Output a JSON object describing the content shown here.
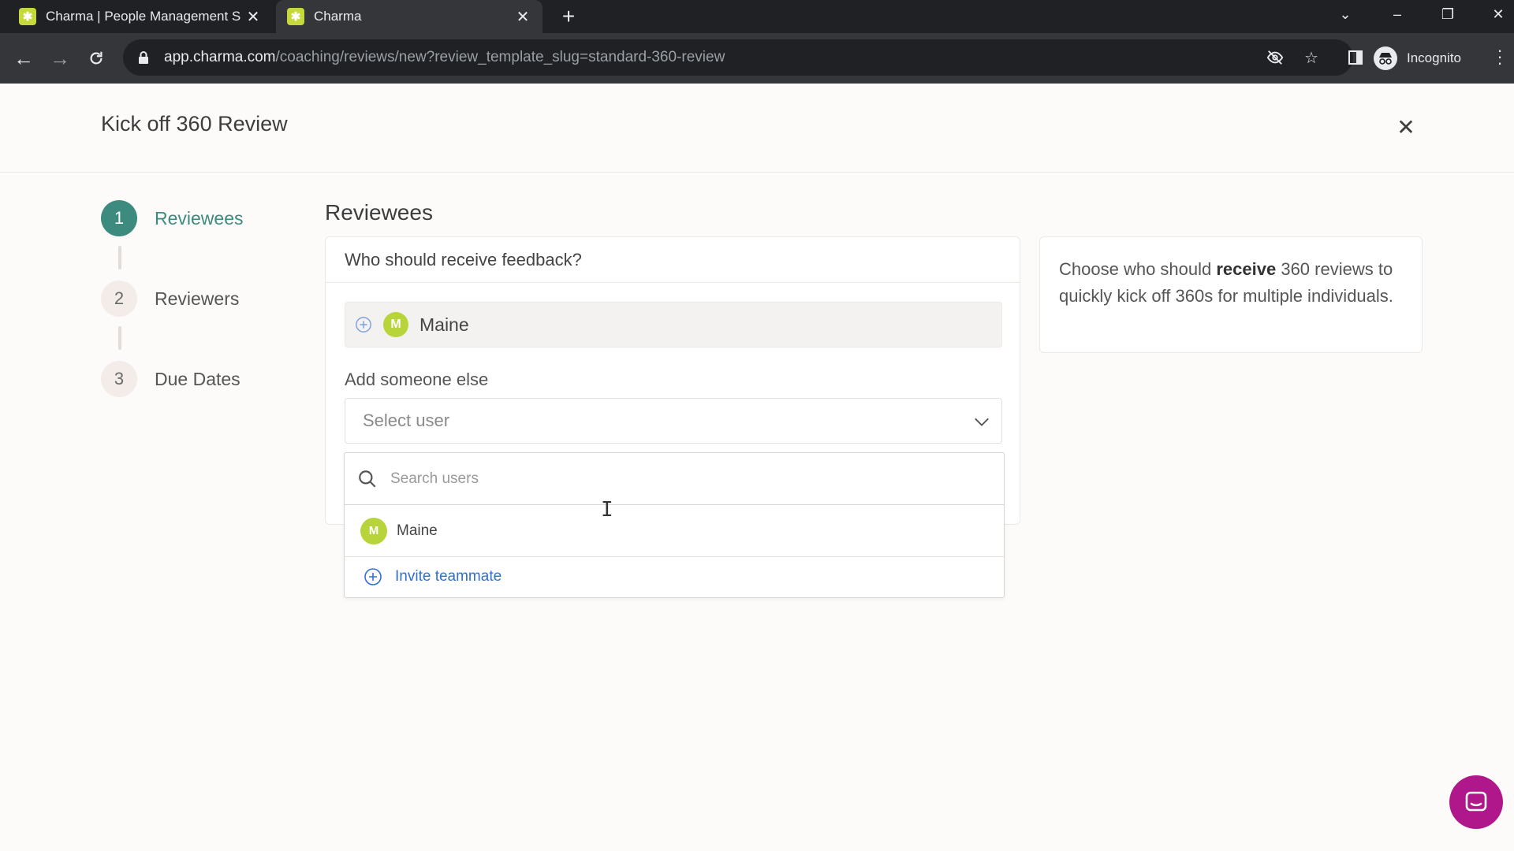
{
  "browser": {
    "tabs": [
      {
        "title": "Charma | People Management S",
        "active": false
      },
      {
        "title": "Charma",
        "active": true
      }
    ],
    "new_tab": "+",
    "url_host": "app.charma.com",
    "url_path": "/coaching/reviews/new?review_template_slug=standard-360-review",
    "profile_label": "Incognito"
  },
  "modal": {
    "title": "Kick off 360 Review",
    "close": "✕"
  },
  "steps": [
    {
      "number": "1",
      "label": "Reviewees",
      "active": true
    },
    {
      "number": "2",
      "label": "Reviewers",
      "active": false
    },
    {
      "number": "3",
      "label": "Due Dates",
      "active": false
    }
  ],
  "section": {
    "title": "Reviewees",
    "question": "Who should receive feedback?",
    "selected_user": {
      "initial": "M",
      "name": "Maine"
    },
    "add_label": "Add someone else",
    "select_placeholder": "Select user"
  },
  "dropdown": {
    "search_placeholder": "Search users",
    "options": [
      {
        "initial": "M",
        "name": "Maine"
      }
    ],
    "invite_label": "Invite teammate"
  },
  "help": {
    "text_before": "Choose who should ",
    "text_bold": "receive",
    "text_after": " 360 reviews to quickly kick off 360s for multiple individuals."
  },
  "colors": {
    "accent": "#3d8a7e",
    "avatar": "#b7d43a",
    "link": "#2f6fd6",
    "chat": "#b0178a"
  },
  "icons": [
    "back-icon",
    "forward-icon",
    "reload-icon",
    "lock-icon",
    "eye-off-icon",
    "star-icon",
    "sidepanel-icon",
    "incognito-icon",
    "close-icon",
    "plus-circle-icon",
    "chevron-down-icon",
    "search-icon",
    "chat-icon"
  ]
}
